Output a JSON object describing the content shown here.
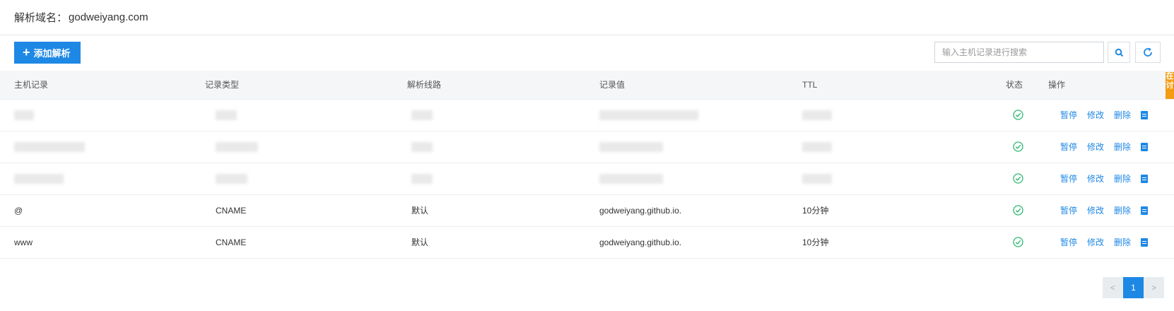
{
  "header": {
    "label": "解析域名：",
    "domain": "godweiyang.com"
  },
  "toolbar": {
    "add_label": "添加解析",
    "search_placeholder": "输入主机记录进行搜索",
    "search_icon": "search-icon",
    "refresh_icon": "refresh-icon"
  },
  "table": {
    "columns": [
      "主机记录",
      "记录类型",
      "解析线路",
      "记录值",
      "TTL",
      "状态",
      "操作"
    ],
    "actions": {
      "pause": "暂停",
      "edit": "修改",
      "delete": "删除"
    },
    "rows": [
      {
        "host": "",
        "type": "",
        "line": "",
        "value": "",
        "ttl": "",
        "redacted": true
      },
      {
        "host": "",
        "type": "",
        "line": "",
        "value": "",
        "ttl": "",
        "redacted": true
      },
      {
        "host": "",
        "type": "",
        "line": "",
        "value": "",
        "ttl": "",
        "redacted": true
      },
      {
        "host": "@",
        "type": "CNAME",
        "line": "默认",
        "value": "godweiyang.github.io.",
        "ttl": "10分钟",
        "redacted": false
      },
      {
        "host": "www",
        "type": "CNAME",
        "line": "默认",
        "value": "godweiyang.github.io.",
        "ttl": "10分钟",
        "redacted": false
      }
    ]
  },
  "side_tab": {
    "text": "在讨"
  },
  "pagination": {
    "prev": "<",
    "current": "1",
    "next": ">"
  },
  "colors": {
    "accent": "#1e88e5",
    "status_ok": "#2eb872",
    "side_tab": "#f39c12"
  }
}
